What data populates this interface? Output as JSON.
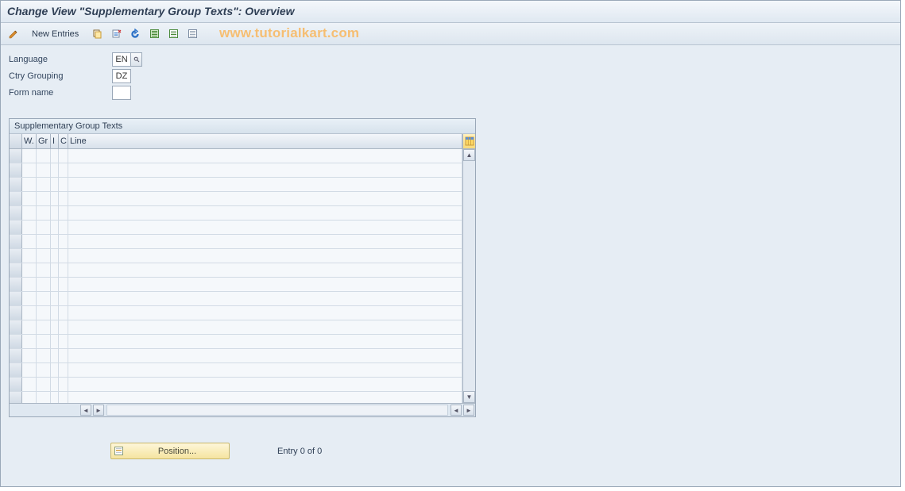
{
  "title": "Change View \"Supplementary Group Texts\": Overview",
  "toolbar": {
    "new_entries": "New Entries"
  },
  "watermark": "www.tutorialkart.com",
  "fields": {
    "language": {
      "label": "Language",
      "value": "EN"
    },
    "ctry_grouping": {
      "label": "Ctry Grouping",
      "value": "DZ"
    },
    "form_name": {
      "label": "Form name",
      "value": ""
    }
  },
  "table": {
    "title": "Supplementary Group Texts",
    "columns": {
      "w": "W.",
      "gr": "Gr",
      "i": "I",
      "c": "C",
      "line": "Line"
    },
    "row_count": 18
  },
  "footer": {
    "position_btn": "Position...",
    "entry_status": "Entry 0 of 0"
  }
}
